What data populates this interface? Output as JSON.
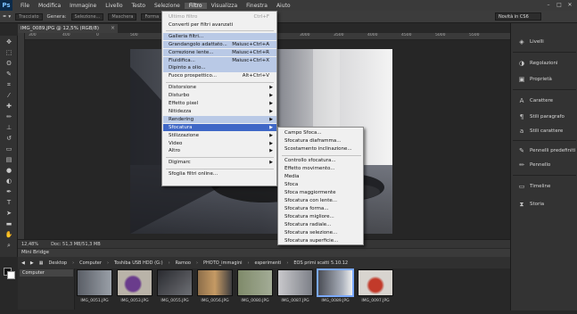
{
  "app": {
    "logo": "Ps"
  },
  "menubar": {
    "items": [
      "File",
      "Modifica",
      "Immagine",
      "Livello",
      "Testo",
      "Selezione",
      "Filtro",
      "Visualizza",
      "Finestra",
      "Aiuto"
    ]
  },
  "optionsbar": {
    "mode": "Tracciato",
    "make_label": "Genera:",
    "selection": "Selezione...",
    "mask": "Maschera",
    "shape": "Forma",
    "workspace": "Novità in CS6"
  },
  "document": {
    "tab_title": "IMG_0089.JPG @ 12,5% (RGB/8)",
    "zoom": "12,48%",
    "doc_size": "Doc: 51,3 MB/51,3 MB",
    "ruler_numbers": [
      "300",
      "400",
      "0",
      "500",
      "1000",
      "1500",
      "2000",
      "2500",
      "3000",
      "3500",
      "4000",
      "4500",
      "5000",
      "5500"
    ]
  },
  "filter_menu": {
    "items": [
      {
        "label": "Ultimo filtro",
        "shortcut": "Ctrl+F",
        "state": "disabled"
      },
      {
        "label": "Converti per filtri avanzati",
        "state": "normal"
      },
      {
        "label": "Galleria filtri...",
        "state": "highlight"
      },
      {
        "label": "Grandangolo adattato...",
        "shortcut": "Maiusc+Ctrl+A",
        "state": "highlight"
      },
      {
        "label": "Correzione lente...",
        "shortcut": "Maiusc+Ctrl+R",
        "state": "highlight"
      },
      {
        "label": "Fluidifica...",
        "shortcut": "Maiusc+Ctrl+X",
        "state": "highlight"
      },
      {
        "label": "Dipinto a olio...",
        "state": "highlight"
      },
      {
        "label": "Fuoco prospettico...",
        "shortcut": "Alt+Ctrl+V",
        "state": "normal"
      },
      {
        "label": "Distorsione",
        "submenu": true,
        "state": "normal"
      },
      {
        "label": "Disturbo",
        "submenu": true,
        "state": "normal"
      },
      {
        "label": "Effetto pixel",
        "submenu": true,
        "state": "normal"
      },
      {
        "label": "Nitidezza",
        "submenu": true,
        "state": "normal"
      },
      {
        "label": "Rendering",
        "submenu": true,
        "state": "highlight"
      },
      {
        "label": "Sfocatura",
        "submenu": true,
        "state": "selected"
      },
      {
        "label": "Stilizzazione",
        "submenu": true,
        "state": "normal"
      },
      {
        "label": "Video",
        "submenu": true,
        "state": "normal"
      },
      {
        "label": "Altro",
        "submenu": true,
        "state": "normal"
      },
      {
        "label": "Digimarc",
        "submenu": true,
        "state": "normal"
      },
      {
        "label": "Sfoglia filtri online...",
        "state": "normal"
      }
    ]
  },
  "blur_submenu": {
    "items": [
      "Campo Sfoca...",
      "Sfocatura diaframma...",
      "Scostamento inclinazione...",
      "Controllo sfocatura...",
      "Effetto movimento...",
      "Media",
      "Sfoca",
      "Sfoca maggiormente",
      "Sfocatura con lente...",
      "Sfocatura forma...",
      "Sfocatura migliore...",
      "Sfocatura radiale...",
      "Sfocatura selezione...",
      "Sfocatura superficie..."
    ]
  },
  "right_dock": {
    "items": [
      "Livelli",
      "Regolazioni",
      "Proprietà",
      "Carattere",
      "Stili paragrafo",
      "Stili carattere",
      "Pennelli predefiniti",
      "Pennello",
      "Timeline",
      "Storia"
    ]
  },
  "minibridge": {
    "tab": "Mini Bridge",
    "breadcrumbs": [
      "Desktop",
      "Computer",
      "Toshiba USB HDD (G:)",
      "Ramoo",
      "PHOTO_immagini",
      "esperimenti",
      "EOS primi scatti 5.10.12"
    ],
    "folder": "Computer",
    "thumbnails": [
      "IMG_0051.JPG",
      "IMG_0053.JPG",
      "IMG_0055.JPG",
      "IMG_0056.JPG",
      "IMG_0080.JPG",
      "IMG_0087.JPG",
      "IMG_0089.JPG",
      "IMG_0097.JPG"
    ],
    "selected_index": 6
  },
  "colors": {
    "menu_selected": "#3f67c6",
    "menu_highlight": "#b9c9e6",
    "panel": "#333333"
  }
}
